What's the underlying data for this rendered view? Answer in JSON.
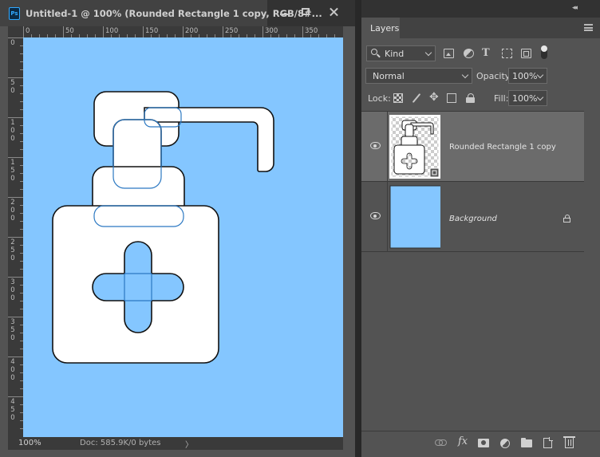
{
  "document": {
    "title": "Untitled-1 @ 100% (Rounded Rectangle 1 copy, RGB/8#...",
    "app_icon": "Ps",
    "window_buttons": [
      "minimize-icon",
      "maximize-icon",
      "close-icon"
    ],
    "canvas_color": "#84c6ff",
    "status": {
      "zoom": "100%",
      "doc_size": "Doc: 585.9K/0 bytes",
      "arrow": "〉"
    },
    "ruler_h": [
      "0",
      "50",
      "100",
      "150",
      "200",
      "250",
      "300",
      "350"
    ],
    "ruler_v": [
      "0",
      "50",
      "100",
      "150",
      "200",
      "250",
      "300",
      "350",
      "400",
      "450"
    ]
  },
  "panel": {
    "collapse": "◂◂",
    "close": "✕",
    "tab": "Layers",
    "filter": {
      "kind": "Kind",
      "icons": [
        "image-filter-icon",
        "adjustment-filter-icon",
        "type-filter-icon",
        "shape-filter-icon",
        "smart-object-filter-icon"
      ]
    },
    "blend_mode": "Normal",
    "opacity_label": "Opacity:",
    "opacity": "100%",
    "lock_label": "Lock:",
    "fill_label": "Fill:",
    "fill": "100%",
    "layers": [
      {
        "name": "Rounded Rectangle 1 copy",
        "selected": true,
        "visible": true
      },
      {
        "name": "Background",
        "selected": false,
        "visible": true,
        "locked": true
      }
    ],
    "bottom_icons": [
      "link-layers-icon",
      "fx-icon",
      "add-mask-icon",
      "adjustment-layer-icon",
      "new-group-icon",
      "new-layer-icon",
      "trash-icon"
    ],
    "fx_label": "fx"
  }
}
